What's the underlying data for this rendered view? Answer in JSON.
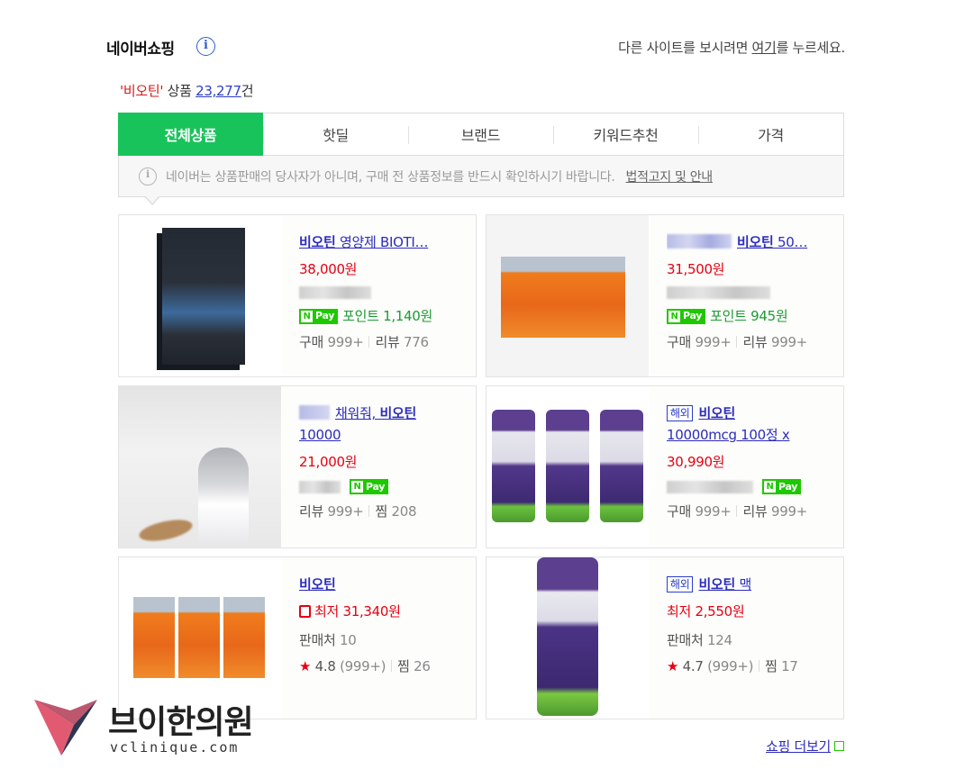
{
  "header": {
    "title": "네이버쇼핑",
    "info_icon": "info-icon",
    "notice_prefix": "다른 사이트를 보시려면 ",
    "notice_link": "여기",
    "notice_suffix": "를 누르세요."
  },
  "count": {
    "keyword": "'비오틴'",
    "label": " 상품 ",
    "number": "23,277",
    "unit": "건"
  },
  "tabs": [
    {
      "label": "전체상품",
      "active": true
    },
    {
      "label": "핫딜"
    },
    {
      "label": "브랜드"
    },
    {
      "label": "키워드추천"
    },
    {
      "label": "가격"
    }
  ],
  "disclaimer": {
    "text": "네이버는 상품판매의 당사자가 아니며, 구매 전 상품정보를 반드시 확인하시기 바랍니다.",
    "legal_link": "법적고지 및 안내"
  },
  "products": [
    {
      "name_bold": "비오틴",
      "name_rest": " 영양제 BIOTI…",
      "price": "38,000원",
      "npay_label": "Pay",
      "npay_n": "N",
      "point": "포인트 1,140원",
      "meta_a_label": "구매",
      "meta_a_value": "999+",
      "meta_b_label": "리뷰",
      "meta_b_value": "776"
    },
    {
      "name_bold": "비오틴",
      "name_rest": " 50…",
      "price": "31,500원",
      "npay_label": "Pay",
      "npay_n": "N",
      "point": "포인트 945원",
      "meta_a_label": "구매",
      "meta_a_value": "999+",
      "meta_b_label": "리뷰",
      "meta_b_value": "999+"
    },
    {
      "name_pre": "채워줘,",
      "name_bold": "비오틴",
      "name_line2": "10000",
      "price": "21,000원",
      "npay_label": "Pay",
      "npay_n": "N",
      "meta_a_label": "리뷰",
      "meta_a_value": "999+",
      "meta_b_label": "찜",
      "meta_b_value": "208"
    },
    {
      "badge": "해외",
      "name_bold": "비오틴",
      "name_line2": "10000mcg 100정 x",
      "price": "30,990원",
      "npay_label": "Pay",
      "npay_n": "N",
      "meta_a_label": "구매",
      "meta_a_value": "999+",
      "meta_b_label": "리뷰",
      "meta_b_value": "999+"
    },
    {
      "name_bold": "비오틴",
      "price": "최저 31,340원",
      "seller_label": "판매처",
      "seller_value": "10",
      "rating": "4.8",
      "rating_count": "(999+)",
      "meta_b_label": "찜",
      "meta_b_value": "26"
    },
    {
      "badge": "해외",
      "name_bold": "비오틴",
      "name_rest": " 맥",
      "price": "최저 2,550원",
      "seller_label": "판매처",
      "seller_value": "124",
      "rating": "4.7",
      "rating_count": "(999+)",
      "meta_b_label": "찜",
      "meta_b_value": "17"
    }
  ],
  "footer": {
    "more_link": "쇼핑 더보기"
  },
  "watermark": {
    "text": "브이한의원",
    "sub": "vclinique.com"
  },
  "colors": {
    "naver_green": "#19c35b",
    "price_red": "#e60012",
    "link_blue": "#2c2cbd"
  }
}
